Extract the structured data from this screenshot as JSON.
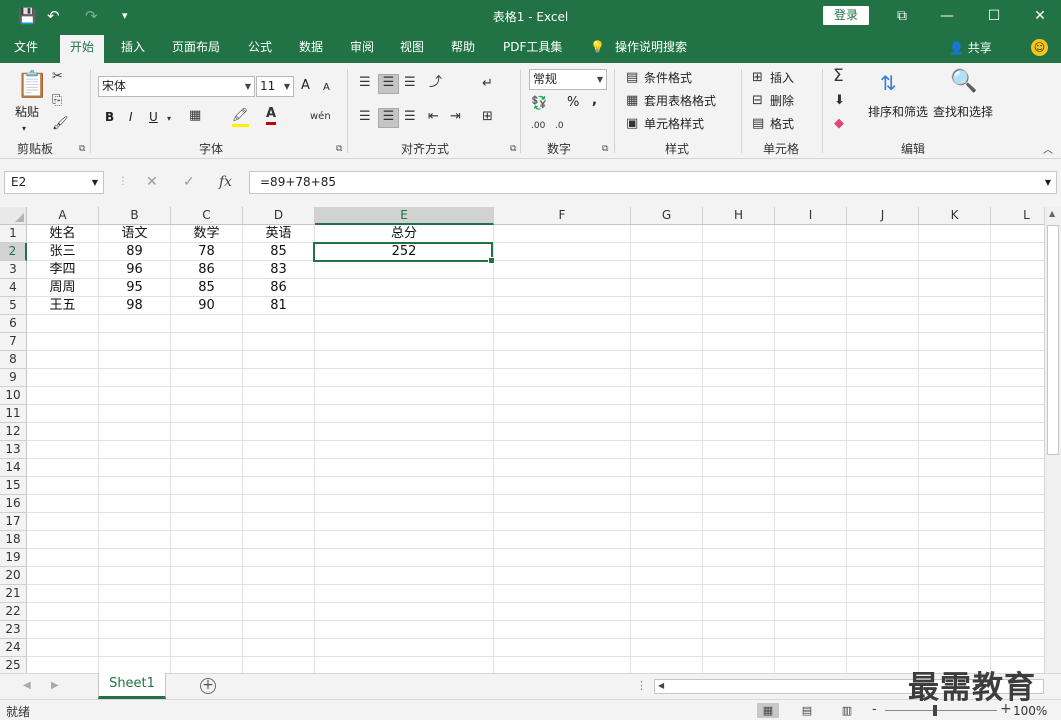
{
  "window": {
    "title": "表格1  -  Excel",
    "login_label": "登录",
    "minimize_icon": "—",
    "restore_icon": "⧉",
    "maximize_icon": "☐",
    "close_icon": "✕"
  },
  "quick_access": {
    "save_icon": "💾",
    "undo_icon": "↶",
    "redo_icon": "↷",
    "customize_icon": "▾"
  },
  "tabs": [
    {
      "label": "文件"
    },
    {
      "label": "开始"
    },
    {
      "label": "插入"
    },
    {
      "label": "页面布局"
    },
    {
      "label": "公式"
    },
    {
      "label": "数据"
    },
    {
      "label": "审阅"
    },
    {
      "label": "视图"
    },
    {
      "label": "帮助"
    },
    {
      "label": "PDF工具集"
    },
    {
      "label": "操作说明搜索"
    }
  ],
  "share_label": "共享",
  "ribbon": {
    "clipboard": {
      "label": "剪贴板",
      "paste": "粘贴"
    },
    "font": {
      "label": "字体",
      "name": "宋体",
      "size": "11",
      "bold": "B",
      "italic": "I",
      "underline": "U",
      "grow": "A",
      "shrink": "A"
    },
    "alignment": {
      "label": "对齐方式"
    },
    "number": {
      "label": "数字",
      "format": "常规",
      "percent": "%",
      "comma": ","
    },
    "styles": {
      "label": "样式",
      "conditional": "条件格式",
      "table": "套用表格格式",
      "cell_styles": "单元格样式"
    },
    "cells": {
      "label": "单元格",
      "insert": "插入",
      "delete": "删除",
      "format": "格式"
    },
    "editing": {
      "label": "编辑",
      "sort_filter": "排序和筛选",
      "find_select": "查找和选择"
    }
  },
  "formula_bar": {
    "name_box": "E2",
    "cancel": "✕",
    "enter": "✓",
    "fx": "fx",
    "formula": "=89+78+85"
  },
  "columns": [
    "A",
    "B",
    "C",
    "D",
    "E",
    "F",
    "G",
    "H",
    "I",
    "J",
    "K",
    "L"
  ],
  "rows": [
    [
      "姓名",
      "语文",
      "数学",
      "英语",
      "总分"
    ],
    [
      "张三",
      "89",
      "78",
      "85",
      "252"
    ],
    [
      "李四",
      "96",
      "86",
      "83",
      ""
    ],
    [
      "周周",
      "95",
      "85",
      "86",
      ""
    ],
    [
      "王五",
      "98",
      "90",
      "81",
      ""
    ]
  ],
  "row_count": 25,
  "sheet": {
    "name": "Sheet1",
    "add_icon": "+"
  },
  "status": {
    "text": "就绪",
    "zoom": "100%",
    "zoom_minus": "-",
    "zoom_plus": "+"
  },
  "watermark": "最需教育"
}
